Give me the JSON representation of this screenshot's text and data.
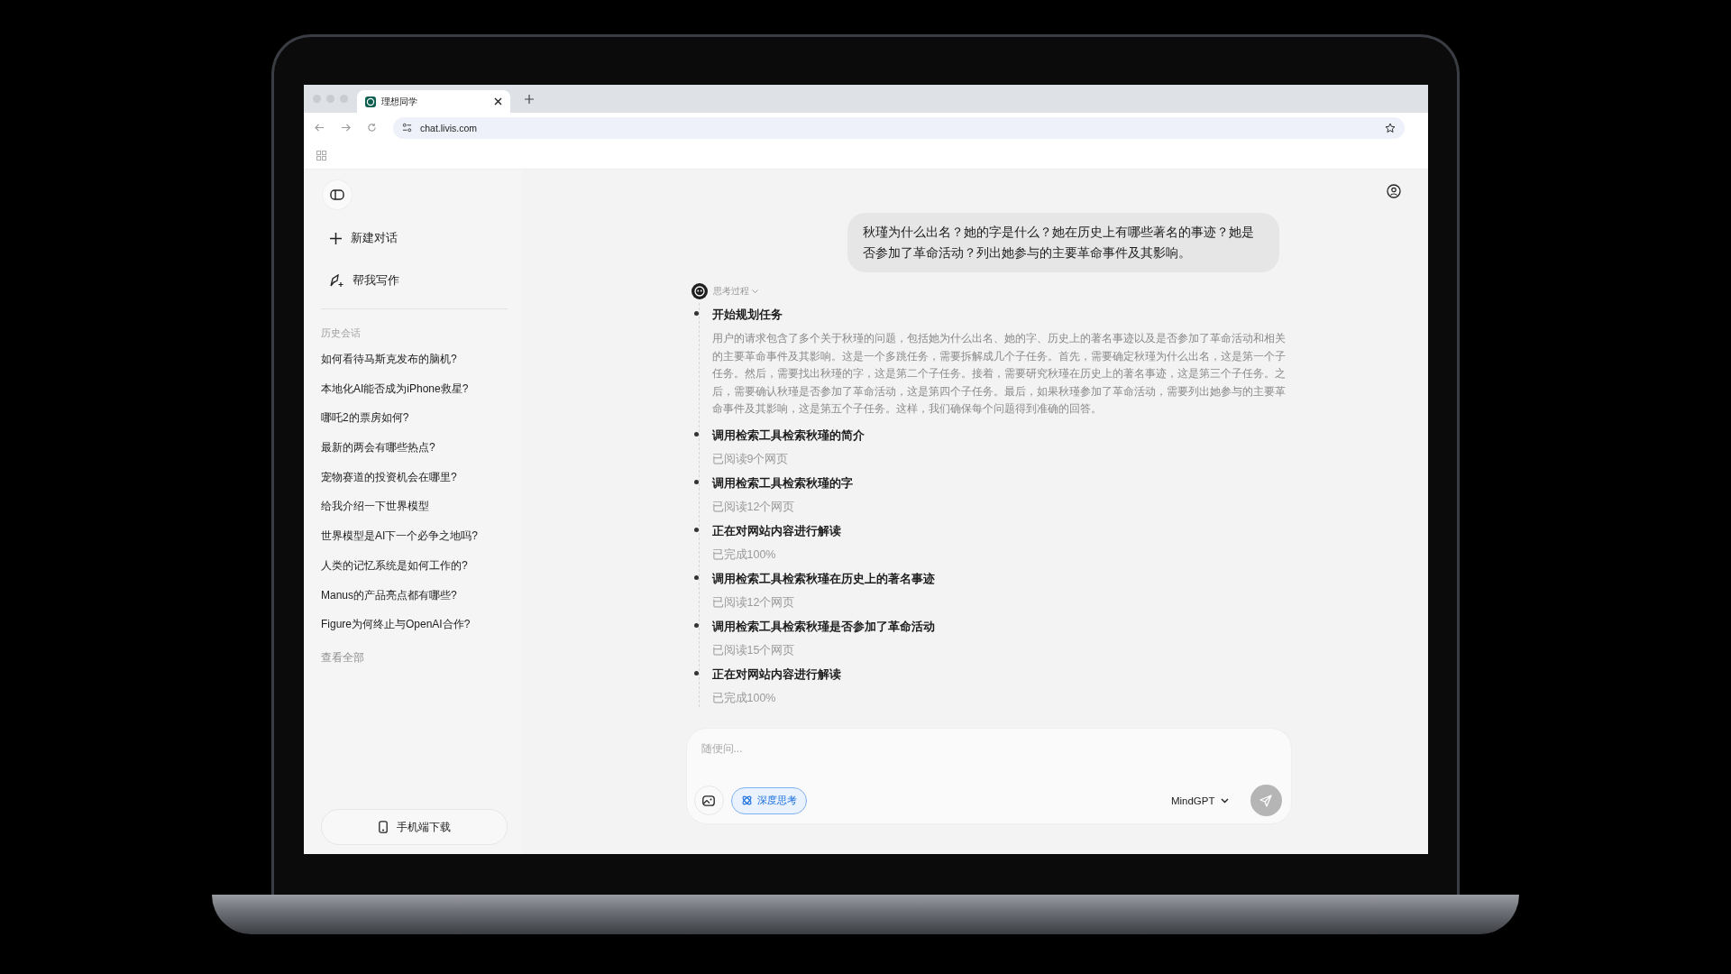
{
  "browser": {
    "tab_title": "理想同学",
    "url": "chat.livis.com"
  },
  "sidebar": {
    "new_chat": "新建对话",
    "write_help": "帮我写作",
    "history_label": "历史会话",
    "history": [
      "如何看待马斯克发布的脑机?",
      "本地化AI能否成为iPhone救星?",
      "哪吒2的票房如何?",
      "最新的两会有哪些热点?",
      "宠物赛道的投资机会在哪里?",
      "给我介绍一下世界模型",
      "世界模型是AI下一个必争之地吗?",
      "人类的记忆系统是如何工作的?",
      "Manus的产品亮点都有哪些?",
      "Figure为何终止与OpenAI合作?"
    ],
    "view_all": "查看全部",
    "download": "手机端下载"
  },
  "conversation": {
    "user_message": "秋瑾为什么出名？她的字是什么？她在历史上有哪些著名的事迹？她是否参加了革命活动？列出她参与的主要革命事件及其影响。",
    "thinking_label": "思考过程",
    "steps": [
      {
        "title": "开始规划任务",
        "detail": "用户的请求包含了多个关于秋瑾的问题，包括她为什么出名、她的字、历史上的著名事迹以及是否参加了革命活动和相关的主要革命事件及其影响。这是一个多跳任务，需要拆解成几个子任务。首先，需要确定秋瑾为什么出名，这是第一个子任务。然后，需要找出秋瑾的字，这是第二个子任务。接着，需要研究秋瑾在历史上的著名事迹，这是第三个子任务。之后，需要确认秋瑾是否参加了革命活动，这是第四个子任务。最后，如果秋瑾参加了革命活动，需要列出她参与的主要革命事件及其影响，这是第五个子任务。这样，我们确保每个问题得到准确的回答。",
        "kind": "paragraph"
      },
      {
        "title": "调用检索工具检索秋瑾的简介",
        "detail": "已阅读9个网页",
        "kind": "status"
      },
      {
        "title": "调用检索工具检索秋瑾的字",
        "detail": "已阅读12个网页",
        "kind": "status"
      },
      {
        "title": "正在对网站内容进行解读",
        "detail": "已完成100%",
        "kind": "status"
      },
      {
        "title": "调用检索工具检索秋瑾在历史上的著名事迹",
        "detail": "已阅读12个网页",
        "kind": "status"
      },
      {
        "title": "调用检索工具检索秋瑾是否参加了革命活动",
        "detail": "已阅读15个网页",
        "kind": "status"
      },
      {
        "title": "正在对网站内容进行解读",
        "detail": "已完成100%",
        "kind": "status"
      }
    ]
  },
  "composer": {
    "placeholder": "随便问...",
    "deep_think": {
      "label": "深度思考",
      "selected": true
    },
    "model": "MindGPT"
  }
}
